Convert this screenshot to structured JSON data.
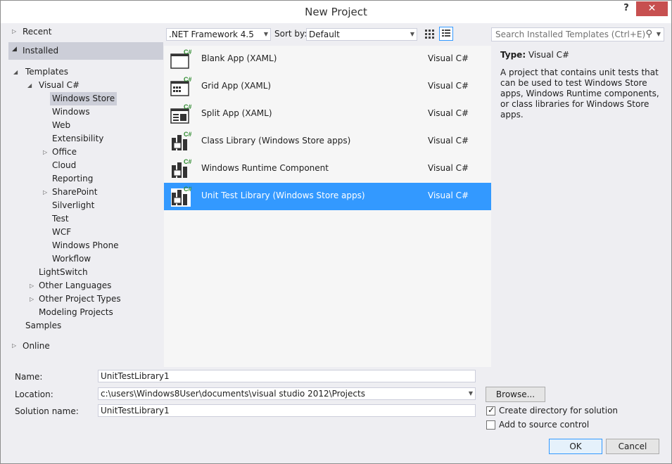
{
  "window": {
    "title": "New Project",
    "help_label": "?",
    "close_label": "✕"
  },
  "tree": {
    "recent": "Recent",
    "installed": "Installed",
    "online": "Online",
    "items": [
      {
        "label": "Templates"
      },
      {
        "label": "Visual C#"
      },
      {
        "label": "Windows Store"
      },
      {
        "label": "Windows"
      },
      {
        "label": "Web"
      },
      {
        "label": "Extensibility"
      },
      {
        "label": "Office"
      },
      {
        "label": "Cloud"
      },
      {
        "label": "Reporting"
      },
      {
        "label": "SharePoint"
      },
      {
        "label": "Silverlight"
      },
      {
        "label": "Test"
      },
      {
        "label": "WCF"
      },
      {
        "label": "Windows Phone"
      },
      {
        "label": "Workflow"
      },
      {
        "label": "LightSwitch"
      },
      {
        "label": "Other Languages"
      },
      {
        "label": "Other Project Types"
      },
      {
        "label": "Modeling Projects"
      },
      {
        "label": "Samples"
      }
    ]
  },
  "toolbar": {
    "framework": ".NET Framework 4.5",
    "sort_by_label": "Sort by:",
    "sort_by_value": "Default",
    "search_placeholder": "Search Installed Templates (Ctrl+E)"
  },
  "templates": [
    {
      "name": "Blank App (XAML)",
      "language": "Visual C#"
    },
    {
      "name": "Grid App (XAML)",
      "language": "Visual C#"
    },
    {
      "name": "Split App (XAML)",
      "language": "Visual C#"
    },
    {
      "name": "Class Library (Windows Store apps)",
      "language": "Visual C#"
    },
    {
      "name": "Windows Runtime Component",
      "language": "Visual C#"
    },
    {
      "name": "Unit Test Library (Windows Store apps)",
      "language": "Visual C#"
    }
  ],
  "description": {
    "type_label": "Type:",
    "type_value": "Visual C#",
    "text": "A project that contains unit tests that can be used to test Windows Store apps, Windows Runtime components, or class libraries for Windows Store apps."
  },
  "form": {
    "name_label": "Name:",
    "name_value": "UnitTestLibrary1",
    "location_label": "Location:",
    "location_value": "c:\\users\\Windows8User\\documents\\visual studio 2012\\Projects",
    "solution_label": "Solution name:",
    "solution_value": "UnitTestLibrary1",
    "browse_label": "Browse...",
    "create_dir_label": "Create directory for solution",
    "source_control_label": "Add to source control",
    "ok_label": "OK",
    "cancel_label": "Cancel"
  },
  "colors": {
    "accent": "#3399ff",
    "installed_highlight": "#ccced8",
    "close_button": "#c75050",
    "csharp_badge": "#2e8b2e"
  }
}
